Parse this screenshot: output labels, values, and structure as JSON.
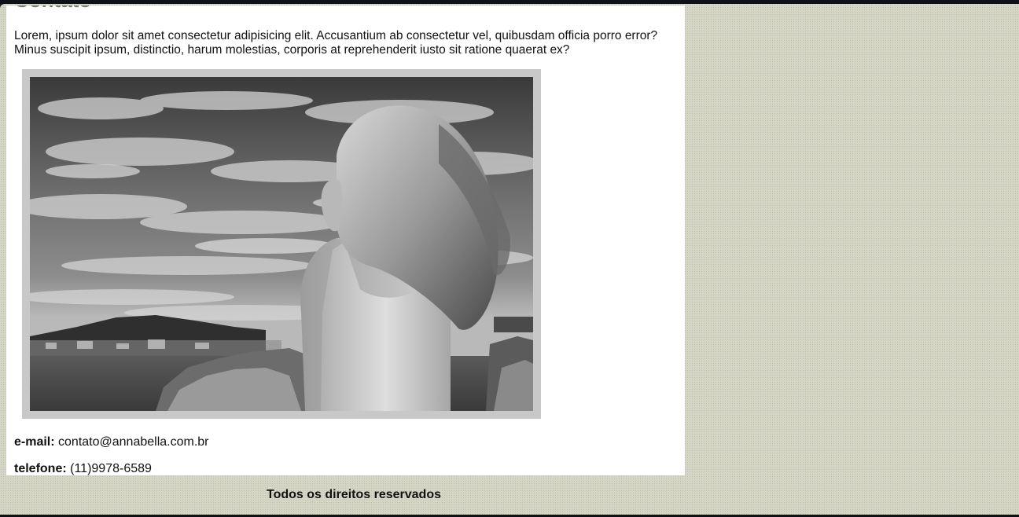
{
  "page": {
    "title": "Contato",
    "intro": "Lorem, ipsum dolor sit amet consectetur adipisicing elit. Accusantium ab consectetur vel, quibusdam officia porro error? Minus suscipit ipsum, distinctio, harum molestias, corporis at reprehenderit iusto sit ratione quaerat ex?"
  },
  "contact": {
    "email_label": "e-mail:",
    "email_value": "contato@annabella.com.br",
    "phone_label": "telefone:",
    "phone_value": "(11)9978-6589"
  },
  "footer": {
    "text": "Todos os direitos reservados"
  },
  "colors": {
    "page_background": "#d6d6c6",
    "content_background": "#ffffff",
    "frame": "#c8c8c8"
  }
}
